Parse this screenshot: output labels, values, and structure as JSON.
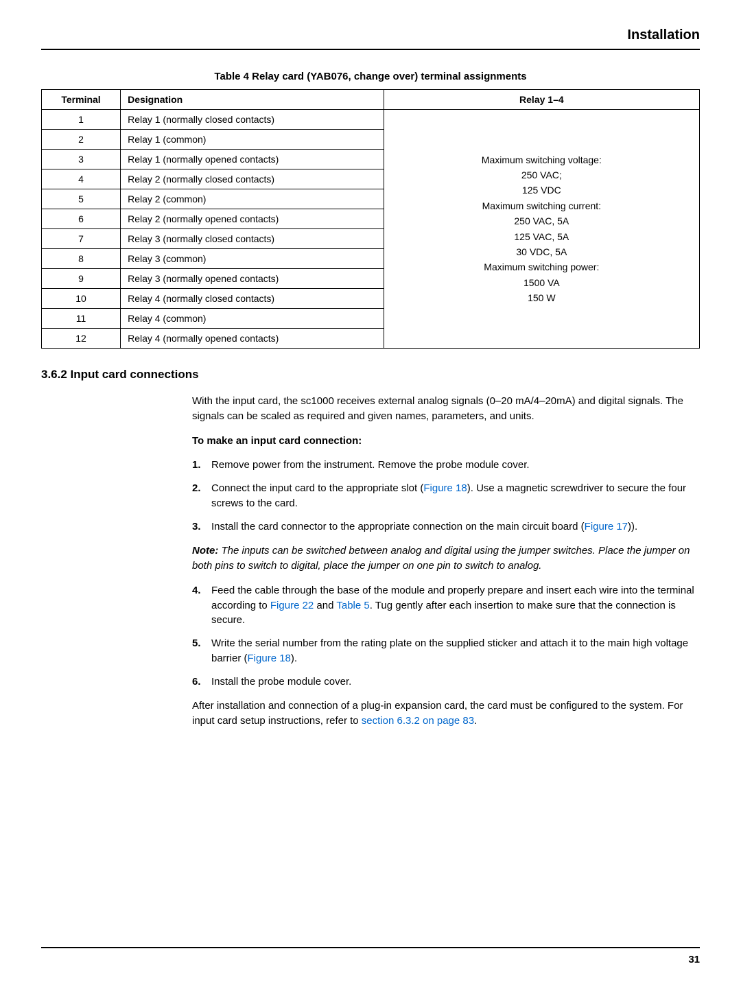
{
  "header": {
    "section_title": "Installation"
  },
  "table": {
    "caption": "Table 4   Relay card (YAB076, change over) terminal assignments",
    "headers": {
      "terminal": "Terminal",
      "designation": "Designation",
      "relay": "Relay 1–4"
    },
    "rows": [
      {
        "terminal": "1",
        "designation": "Relay 1 (normally closed contacts)"
      },
      {
        "terminal": "2",
        "designation": "Relay 1 (common)"
      },
      {
        "terminal": "3",
        "designation": "Relay 1 (normally opened contacts)"
      },
      {
        "terminal": "4",
        "designation": "Relay 2 (normally closed contacts)"
      },
      {
        "terminal": "5",
        "designation": "Relay 2 (common)"
      },
      {
        "terminal": "6",
        "designation": "Relay 2 (normally opened contacts)"
      },
      {
        "terminal": "7",
        "designation": "Relay 3 (normally closed contacts)"
      },
      {
        "terminal": "8",
        "designation": "Relay 3 (common)"
      },
      {
        "terminal": "9",
        "designation": "Relay 3 (normally opened contacts)"
      },
      {
        "terminal": "10",
        "designation": "Relay 4 (normally closed contacts)"
      },
      {
        "terminal": "11",
        "designation": "Relay 4 (common)"
      },
      {
        "terminal": "12",
        "designation": "Relay 4 (normally opened contacts)"
      }
    ],
    "relay_lines": [
      "Maximum switching voltage:",
      "250 VAC;",
      "125 VDC",
      "Maximum switching current:",
      "250 VAC, 5A",
      "125 VAC, 5A",
      "30 VDC, 5A",
      "Maximum switching power:",
      "1500 VA",
      "150 W"
    ]
  },
  "section": {
    "heading": "3.6.2   Input card connections",
    "intro": "With the input card, the sc1000 receives external analog signals (0–20 mA/4–20mA) and digital signals. The signals can be scaled as required and given names, parameters, and units.",
    "sub": "To make an input card connection:",
    "steps1": [
      {
        "text": "Remove power from the instrument. Remove the probe module cover."
      },
      {
        "pre": "Connect the input card to the appropriate slot (",
        "link": "Figure 18",
        "post": "). Use a magnetic screwdriver to secure the four screws to the card."
      },
      {
        "pre": "Install the card connector to the appropriate connection on the main circuit board (",
        "link": "Figure 17",
        "post": "))."
      }
    ],
    "note_label": "Note:",
    "note_body": " The inputs can be switched between analog and digital using the jumper switches. Place the jumper on both pins to switch to digital, place the jumper on one pin to switch to analog.",
    "steps2": [
      {
        "pre": "Feed the cable through the base of the module and properly prepare and insert each wire into the terminal according to ",
        "link1": "Figure 22",
        "mid": " and ",
        "link2": "Table 5",
        "post": ". Tug gently after each insertion to make sure that the connection is secure."
      },
      {
        "pre": "Write the serial number from the rating plate on the supplied sticker and attach it to the main high voltage barrier (",
        "link": "Figure 18",
        "post": ")."
      },
      {
        "text": "Install the probe module cover."
      }
    ],
    "outro_pre": "After installation and connection of a plug-in expansion card, the card must be configured to the system. For input card setup instructions, refer to ",
    "outro_link": "section 6.3.2 on page 83",
    "outro_post": "."
  },
  "footer": {
    "page": "31"
  }
}
